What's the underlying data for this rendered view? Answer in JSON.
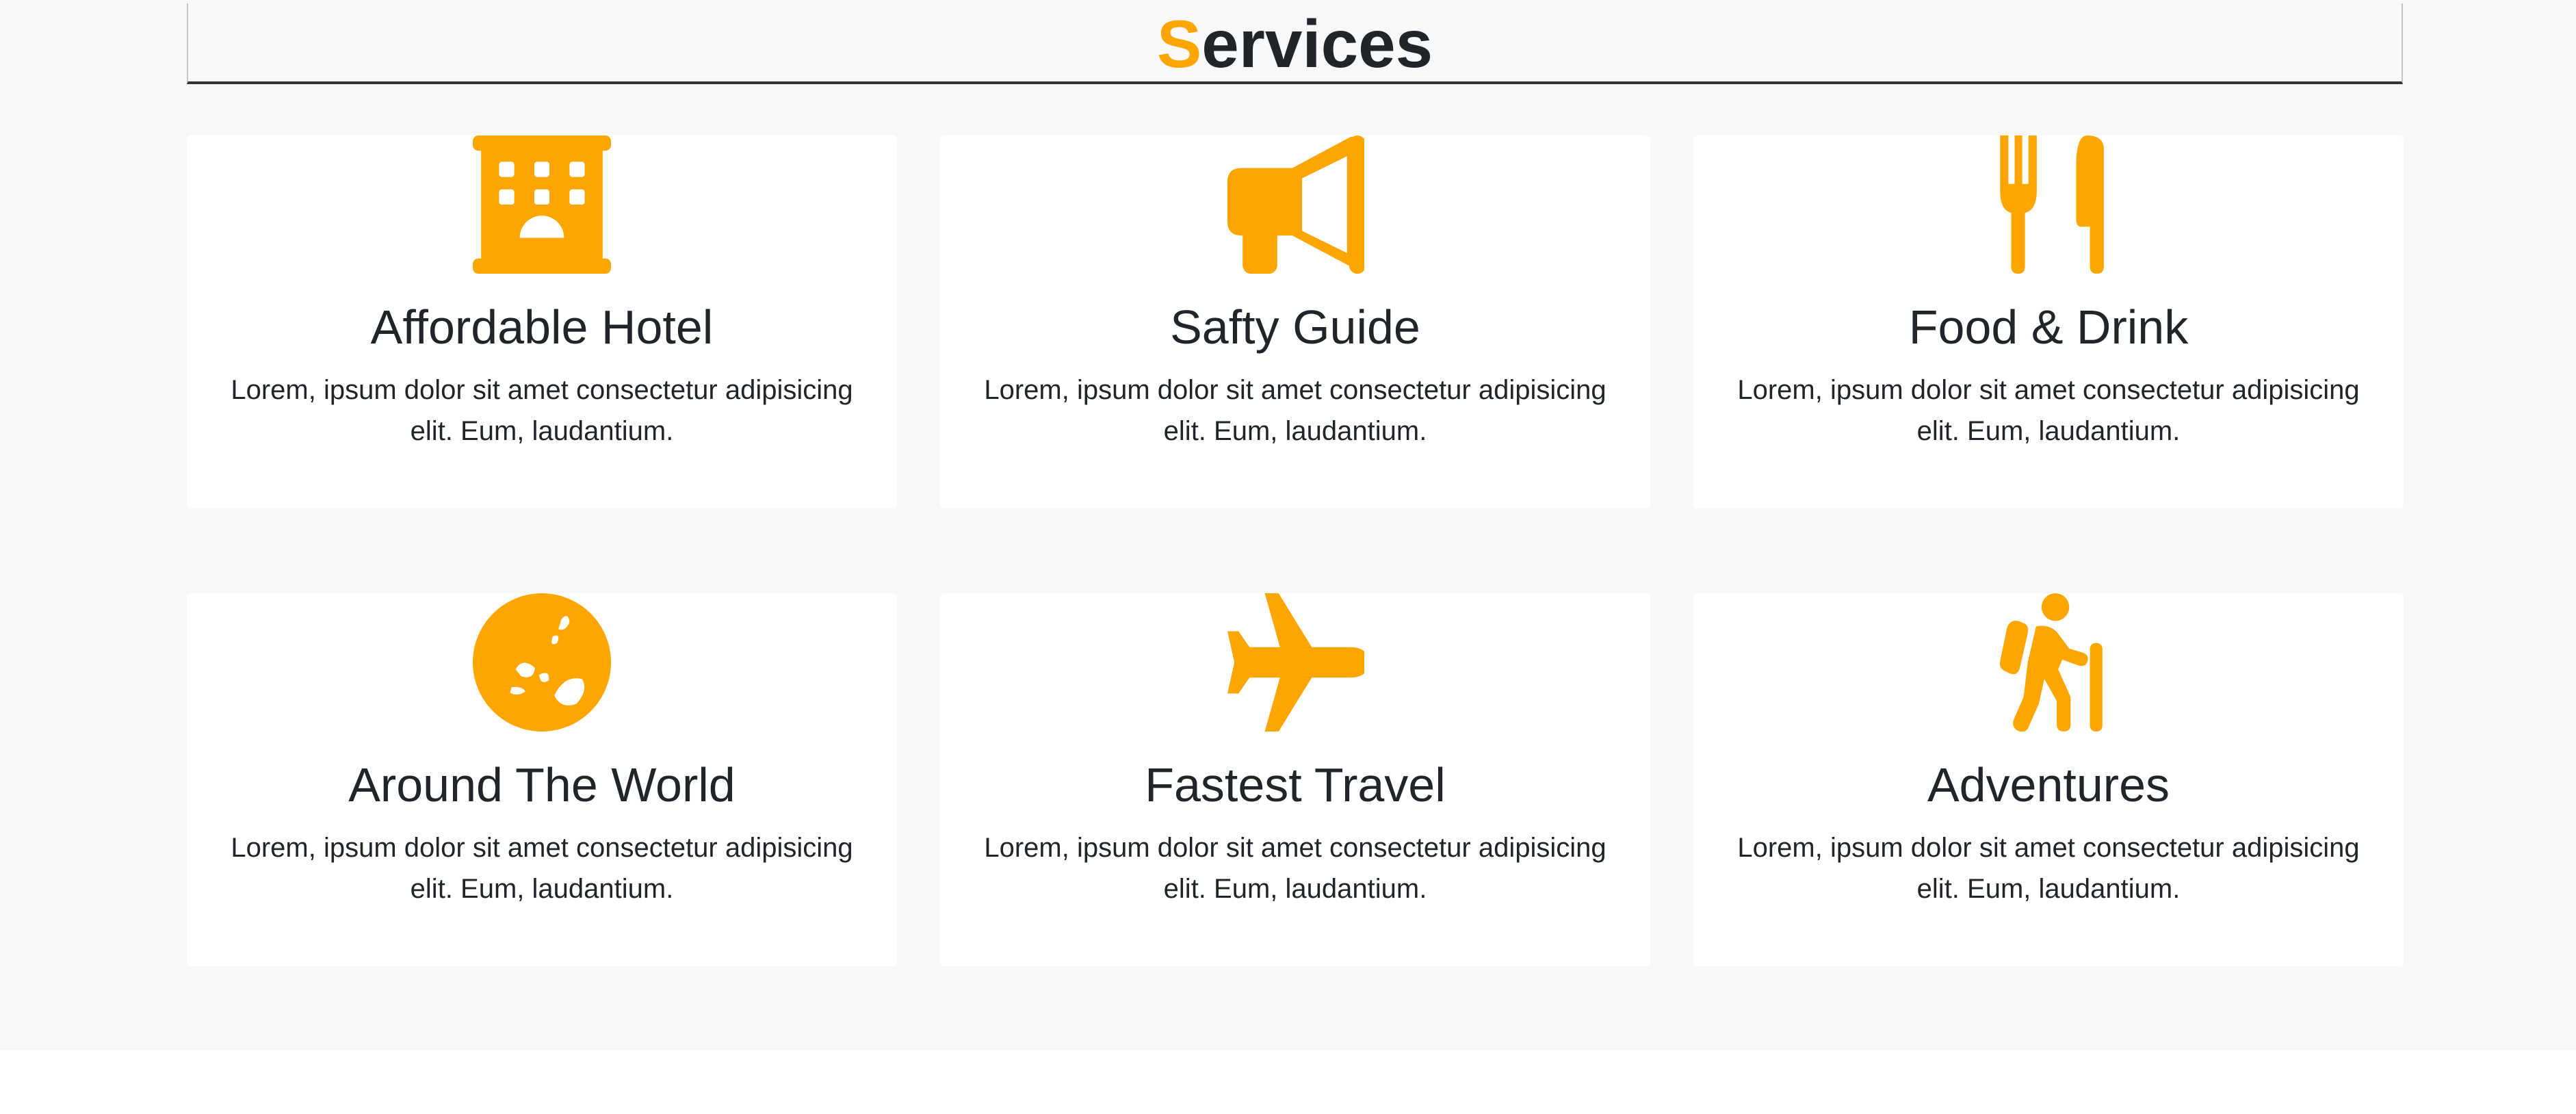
{
  "section": {
    "heading_first_letter": "S",
    "heading_rest": "ervices",
    "accent_color": "#ffa500"
  },
  "cards": [
    {
      "icon": "hotel-icon",
      "title": "Affordable Hotel",
      "text": "Lorem, ipsum dolor sit amet consectetur adipisicing elit. Eum, laudantium."
    },
    {
      "icon": "megaphone-icon",
      "title": "Safty Guide",
      "text": "Lorem, ipsum dolor sit amet consectetur adipisicing elit. Eum, laudantium."
    },
    {
      "icon": "utensils-icon",
      "title": "Food & Drink",
      "text": "Lorem, ipsum dolor sit amet consectetur adipisicing elit. Eum, laudantium."
    },
    {
      "icon": "globe-icon",
      "title": "Around The World",
      "text": "Lorem, ipsum dolor sit amet consectetur adipisicing elit. Eum, laudantium."
    },
    {
      "icon": "plane-icon",
      "title": "Fastest Travel",
      "text": "Lorem, ipsum dolor sit amet consectetur adipisicing elit. Eum, laudantium."
    },
    {
      "icon": "hiking-icon",
      "title": "Adventures",
      "text": "Lorem, ipsum dolor sit amet consectetur adipisicing elit. Eum, laudantium."
    }
  ]
}
